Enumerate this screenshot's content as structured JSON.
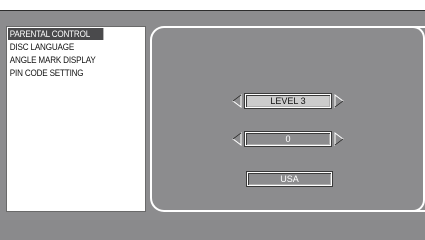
{
  "menu": {
    "items": [
      {
        "label": "PARENTAL CONTROL",
        "selected": true
      },
      {
        "label": "DISC LANGUAGE",
        "selected": false
      },
      {
        "label": "ANGLE MARK DISPLAY",
        "selected": false
      },
      {
        "label": "PIN CODE SETTING",
        "selected": false
      }
    ]
  },
  "settings": {
    "level": "LEVEL 3",
    "value": "0",
    "country": "USA"
  },
  "colors": {
    "background": "#8c8c8e",
    "menu_background": "#ffffff",
    "selected_item": "#4a4a4c",
    "highlight_box": "#cccccc"
  },
  "icons": {
    "left_arrow": "triangle-left-icon",
    "right_arrow": "triangle-right-icon"
  }
}
